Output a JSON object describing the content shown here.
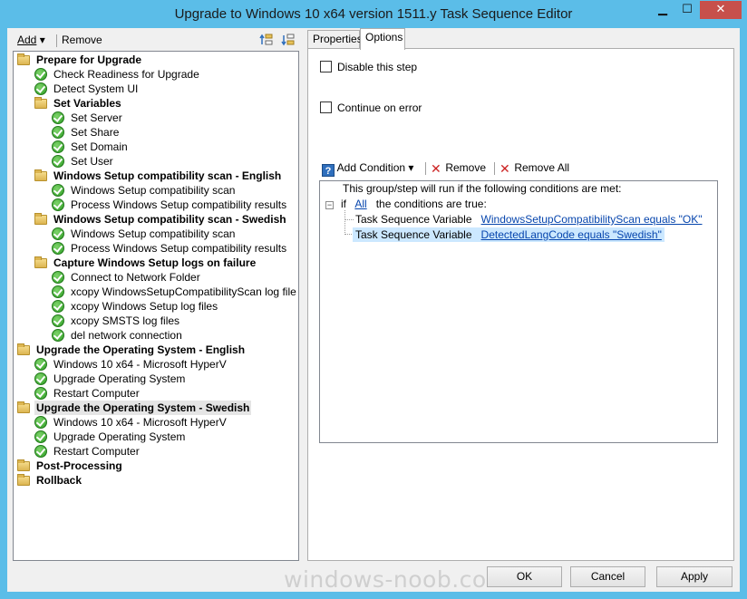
{
  "window": {
    "title": "Upgrade to Windows 10 x64 version 1511.y Task Sequence Editor",
    "min_glyph": "▁",
    "max_glyph": "☐",
    "close_glyph": "✕"
  },
  "left_toolbar": {
    "add_label": "Add",
    "add_arrow": "▾",
    "remove_label": "Remove"
  },
  "tree": [
    {
      "label": "Prepare for Upgrade",
      "type": "group",
      "level": 0
    },
    {
      "label": "Check Readiness for Upgrade",
      "type": "step",
      "level": 1
    },
    {
      "label": "Detect System UI",
      "type": "step",
      "level": 1
    },
    {
      "label": "Set Variables",
      "type": "group",
      "level": 1
    },
    {
      "label": "Set Server",
      "type": "step",
      "level": 2
    },
    {
      "label": "Set Share",
      "type": "step",
      "level": 2
    },
    {
      "label": "Set Domain",
      "type": "step",
      "level": 2
    },
    {
      "label": "Set User",
      "type": "step",
      "level": 2
    },
    {
      "label": "Windows Setup compatibility scan - English",
      "type": "group",
      "level": 1
    },
    {
      "label": "Windows Setup compatibility scan",
      "type": "step",
      "level": 2
    },
    {
      "label": "Process Windows Setup compatibility results",
      "type": "step",
      "level": 2
    },
    {
      "label": "Windows Setup compatibility scan - Swedish",
      "type": "group",
      "level": 1
    },
    {
      "label": "Windows Setup compatibility scan",
      "type": "step",
      "level": 2
    },
    {
      "label": "Process Windows Setup compatibility results",
      "type": "step",
      "level": 2
    },
    {
      "label": "Capture Windows Setup logs on failure",
      "type": "group",
      "level": 1
    },
    {
      "label": "Connect to Network Folder",
      "type": "step",
      "level": 2
    },
    {
      "label": "xcopy WindowsSetupCompatibilityScan log file",
      "type": "step",
      "level": 2
    },
    {
      "label": "xcopy Windows Setup log files",
      "type": "step",
      "level": 2
    },
    {
      "label": "xcopy SMSTS log files",
      "type": "step",
      "level": 2
    },
    {
      "label": "del network connection",
      "type": "step",
      "level": 2
    },
    {
      "label": "Upgrade the Operating System - English",
      "type": "group",
      "level": 0
    },
    {
      "label": "Windows 10 x64 - Microsoft HyperV",
      "type": "step",
      "level": 1
    },
    {
      "label": "Upgrade Operating System",
      "type": "step",
      "level": 1
    },
    {
      "label": "Restart Computer",
      "type": "step",
      "level": 1
    },
    {
      "label": "Upgrade the Operating System - Swedish",
      "type": "group",
      "level": 0,
      "selected": true
    },
    {
      "label": "Windows 10 x64 - Microsoft HyperV",
      "type": "step",
      "level": 1
    },
    {
      "label": "Upgrade Operating System",
      "type": "step",
      "level": 1
    },
    {
      "label": "Restart Computer",
      "type": "step",
      "level": 1
    },
    {
      "label": "Post-Processing",
      "type": "group",
      "level": 0
    },
    {
      "label": "Rollback",
      "type": "group",
      "level": 0
    }
  ],
  "tabs": {
    "properties": "Properties",
    "options": "Options"
  },
  "options": {
    "disable_step": "Disable this step",
    "continue_on_error": "Continue on error",
    "add_condition": "Add Condition",
    "remove": "Remove",
    "remove_all": "Remove All",
    "intro": "This group/step will run if the following conditions are met:",
    "if_label": "if",
    "all_link": "All",
    "cond_true": "the conditions are true:",
    "conditions": [
      {
        "kind": "Task Sequence Variable",
        "expr": "WindowsSetupCompatibilityScan equals \"OK\""
      },
      {
        "kind": "Task Sequence Variable",
        "expr": "DetectedLangCode equals \"Swedish\""
      }
    ]
  },
  "buttons": {
    "ok": "OK",
    "cancel": "Cancel",
    "apply": "Apply"
  },
  "watermark": "windows-noob.com",
  "colors": {
    "window_frame": "#5bbde8",
    "close_button": "#c7504b",
    "link": "#0645ad",
    "highlight": "#cce8ff",
    "check_green": "#2c9c23"
  }
}
